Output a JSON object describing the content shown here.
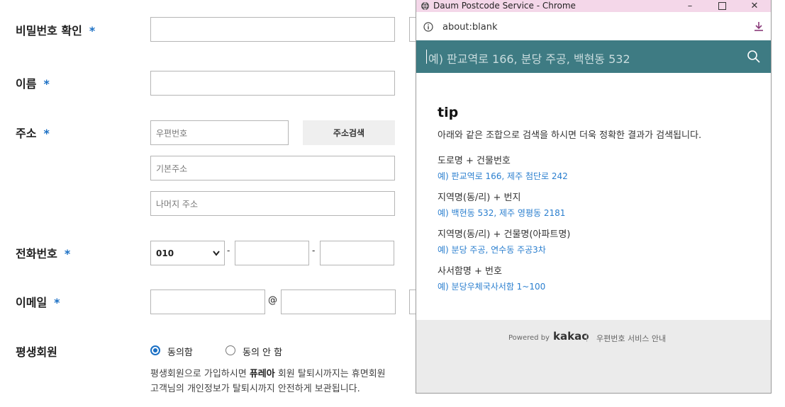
{
  "form": {
    "password_confirm_label": "비밀번호 확인",
    "name_label": "이름",
    "address_label": "주소",
    "phone_label": "전화번호",
    "email_label": "이메일",
    "lifetime_label": "평생회원",
    "required_mark": "*",
    "postcode_placeholder": "우편번호",
    "address_search_button": "주소검색",
    "basic_address_placeholder": "기본주소",
    "detail_address_placeholder": "나머지 주소",
    "phone_prefix": "010",
    "phone_sep": "-",
    "email_at": "@",
    "agree_option": "동의함",
    "disagree_option": "동의 안 함",
    "desc_line1_pre": "평생회원으로 가입하시면 ",
    "desc_line1_bold": "퓨레아",
    "desc_line1_post": " 회원 탈퇴시까지는 휴면회원",
    "desc_line2": "고객님의 개인정보가 탈퇴시까지 안전하게 보관됩니다."
  },
  "popup": {
    "window_title": "Daum Postcode Service - Chrome",
    "url": "about:blank",
    "search_placeholder": "예) 판교역로 166, 분당 주공, 백현동 532",
    "tip_title": "tip",
    "tip_desc": "아래와 같은 조합으로 검색을 하시면 더욱 정확한 결과가 검색됩니다.",
    "tips": [
      {
        "heading": "도로명 + 건물번호",
        "example": "예) 판교역로 166,  제주 첨단로 242"
      },
      {
        "heading": "지역명(동/리) + 번지",
        "example": "예) 백현동 532,  제주 영평동 2181"
      },
      {
        "heading": "지역명(동/리) + 건물명(아파트명)",
        "example": "예) 분당 주공,  연수동 주공3차"
      },
      {
        "heading": "사서함명 + 번호",
        "example": "예) 분당우체국사서함 1~100"
      }
    ],
    "powered_by": "Powered by",
    "brand": "kakao",
    "service_guide": "우편번호 서비스 안내"
  },
  "colors": {
    "accent": "#3e7b83",
    "link": "#2b7fcf",
    "titlebar": "#f4d7e9",
    "required": "#1a6fc4"
  }
}
